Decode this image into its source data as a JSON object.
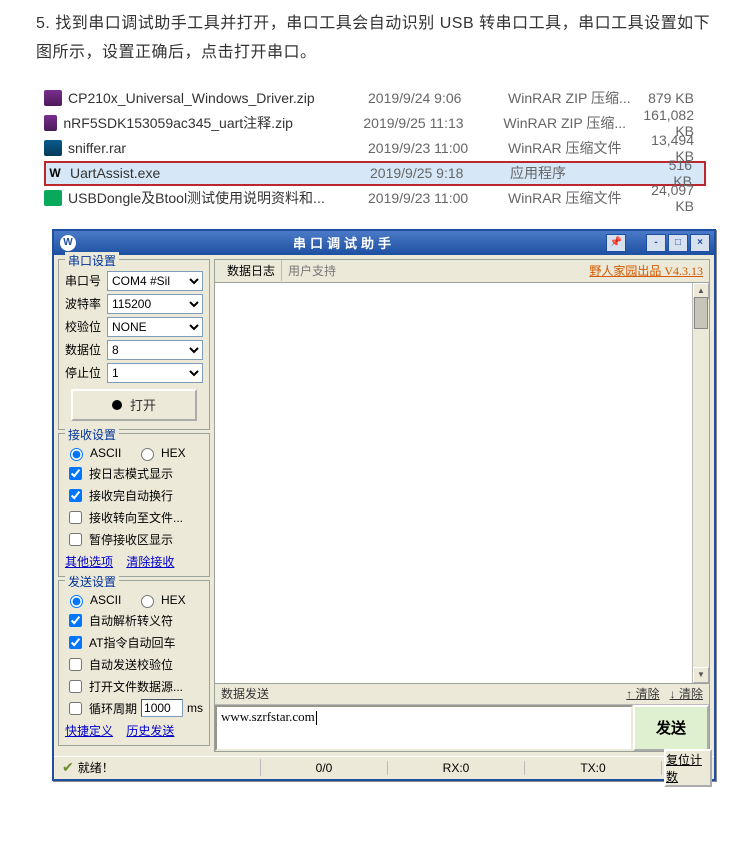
{
  "instruction": "5. 找到串口调试助手工具并打开，串口工具会自动识别 USB 转串口工具，串口工具设置如下图所示，设置正确后，点击打开串口。",
  "files": [
    {
      "name": "CP210x_Universal_Windows_Driver.zip",
      "date": "2019/9/24 9:06",
      "type": "WinRAR ZIP 压缩...",
      "size": "879 KB",
      "icon": "zip"
    },
    {
      "name": "nRF5SDK153059ac345_uart注释.zip",
      "date": "2019/9/25 11:13",
      "type": "WinRAR ZIP 压缩...",
      "size": "161,082 KB",
      "icon": "zip"
    },
    {
      "name": "sniffer.rar",
      "date": "2019/9/23 11:00",
      "type": "WinRAR 压缩文件",
      "size": "13,494 KB",
      "icon": "rar"
    },
    {
      "name": "UartAssist.exe",
      "date": "2019/9/25 9:18",
      "type": "应用程序",
      "size": "516 KB",
      "icon": "exe",
      "selected": true
    },
    {
      "name": "USBDongle及Btool测试使用说明资料和...",
      "date": "2019/9/23 11:00",
      "type": "WinRAR 压缩文件",
      "size": "24,097 KB",
      "icon": "pdf"
    }
  ],
  "app": {
    "title": "串口调试助手",
    "titlebar_min": "-",
    "titlebar_max": "□",
    "titlebar_close": "×",
    "titlebar_pin": "📌",
    "serial_group": "串口设置",
    "serial": {
      "port_label": "串口号",
      "port_value": "COM4 #Sil",
      "baud_label": "波特率",
      "baud_value": "115200",
      "parity_label": "校验位",
      "parity_value": "NONE",
      "databits_label": "数据位",
      "databits_value": "8",
      "stopbits_label": "停止位",
      "stopbits_value": "1",
      "open": "打开"
    },
    "recv_group": "接收设置",
    "recv": {
      "ascii": "ASCII",
      "hex": "HEX",
      "by_log": "按日志模式显示",
      "auto_wrap": "接收完自动换行",
      "to_file": "接收转向至文件...",
      "pause": "暂停接收区显示",
      "other": "其他选项",
      "clear": "清除接收"
    },
    "send_group": "发送设置",
    "send_opts": {
      "ascii": "ASCII",
      "hex": "HEX",
      "escape": "自动解析转义符",
      "at_cr": "AT指令自动回车",
      "auto_chk": "自动发送校验位",
      "open_file": "打开文件数据源...",
      "cycle_label": "循环周期",
      "cycle_value": "1000",
      "cycle_unit": "ms",
      "shortcut": "快捷定义",
      "history": "历史发送"
    },
    "right": {
      "tab_log": "数据日志",
      "tab_support": "用户支持",
      "brand": "野人家园出品  V4.3.13",
      "send_header": "数据发送",
      "send_clear_up": "清除",
      "send_clear_down": "清除",
      "send_value": "www.szrfstar.com",
      "send_btn": "发送"
    },
    "status": {
      "ready": "就绪！",
      "counts": "0/0",
      "rx": "RX:0",
      "tx": "TX:0",
      "reset": "复位计数"
    }
  }
}
